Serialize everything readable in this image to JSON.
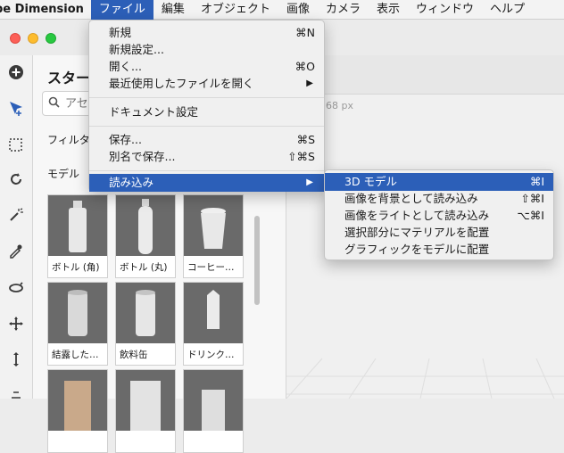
{
  "menubar": {
    "app_name": "be Dimension",
    "items": [
      "ファイル",
      "編集",
      "オブジェクト",
      "画像",
      "カメラ",
      "表示",
      "ウィンドウ",
      "ヘルプ"
    ]
  },
  "panel": {
    "title": "スターター",
    "search_placeholder": "アセ",
    "filter_label": "フィルタ",
    "models_label": "モデル",
    "models": [
      "ボトル (角)",
      "ボトル (丸)",
      "コーヒー…",
      "結露した…",
      "飲料缶",
      "ドリンク…",
      "",
      "",
      ""
    ]
  },
  "canvas": {
    "size_label": "68 px"
  },
  "file_menu": {
    "items": [
      {
        "label": "新規",
        "shortcut": "⌘N"
      },
      {
        "label": "新規設定...",
        "shortcut": ""
      },
      {
        "label": "開く...",
        "shortcut": "⌘O"
      },
      {
        "label": "最近使用したファイルを開く",
        "shortcut": "▶"
      },
      {
        "label": "ドキュメント設定",
        "shortcut": ""
      },
      {
        "label": "保存...",
        "shortcut": "⌘S"
      },
      {
        "label": "別名で保存...",
        "shortcut": "⇧⌘S"
      },
      {
        "label": "読み込み",
        "shortcut": "▶"
      }
    ]
  },
  "import_submenu": {
    "items": [
      {
        "label": "3D モデル",
        "shortcut": "⌘I"
      },
      {
        "label": "画像を背景として読み込み",
        "shortcut": "⇧⌘I"
      },
      {
        "label": "画像をライトとして読み込み",
        "shortcut": "⌥⌘I"
      },
      {
        "label": "選択部分にマテリアルを配置",
        "shortcut": ""
      },
      {
        "label": "グラフィックをモデルに配置",
        "shortcut": ""
      }
    ]
  },
  "colors": {
    "accent": "#2c5fb8"
  }
}
